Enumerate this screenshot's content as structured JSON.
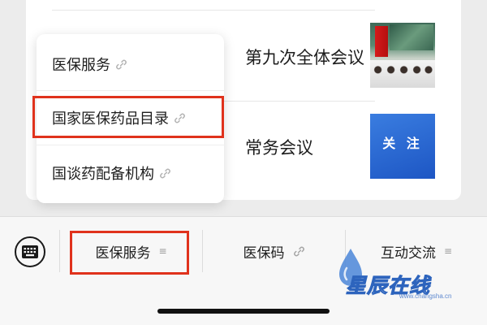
{
  "articles": [
    {
      "title_fragment": ""
    },
    {
      "title_fragment": "第九次全体会议",
      "thumb": "meeting-photo"
    },
    {
      "title_fragment": "常务会议",
      "thumb_text": "关 注"
    }
  ],
  "popup_menu": {
    "items": [
      {
        "label": "医保服务",
        "icon": "link-icon"
      },
      {
        "label": "国家医保药品目录",
        "icon": "link-icon"
      },
      {
        "label": "国谈药配备机构",
        "icon": "link-icon"
      }
    ],
    "highlighted_index": 1
  },
  "menu_bar": {
    "keyboard_icon": "keyboard-icon",
    "items": [
      {
        "label": "医保服务",
        "icon": "list-icon"
      },
      {
        "label": "医保码",
        "icon": "link-icon"
      },
      {
        "label": "互动交流",
        "icon": "list-icon"
      }
    ],
    "highlighted_index": 0
  },
  "watermark": {
    "text": "星辰在线",
    "domain": "www.changsha.cn"
  },
  "colors": {
    "highlight_box": "#e0321c",
    "follow_thumb": "#2a6ad8",
    "background": "#ececec"
  }
}
